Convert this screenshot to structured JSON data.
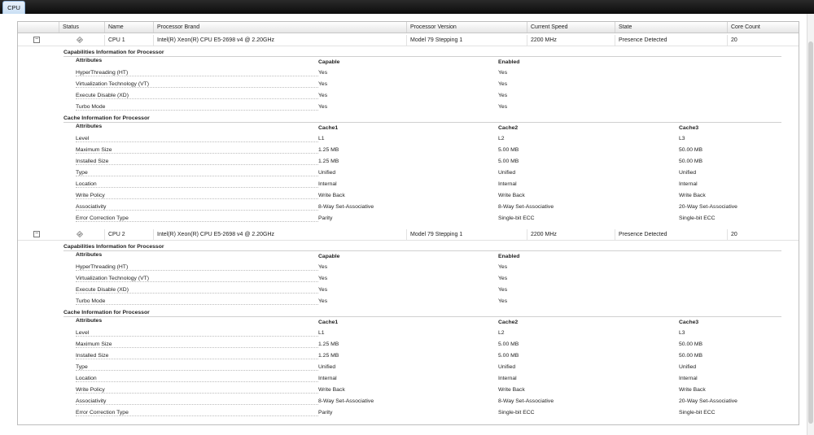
{
  "tab": {
    "label": "CPU"
  },
  "columns": [
    "Status",
    "Name",
    "Processor Brand",
    "Processor Version",
    "Current Speed",
    "State",
    "Core Count"
  ],
  "processors": [
    {
      "toggle": "−",
      "name": "CPU 1",
      "brand": "Intel(R) Xeon(R) CPU E5-2698 v4 @ 2.20GHz",
      "version": "Model 79 Stepping 1",
      "speed": "2200 MHz",
      "state": "Presence Detected",
      "cores": "20",
      "capabilities": {
        "title": "Capabilities Information for Processor",
        "headers": [
          "Attributes",
          "Capable",
          "Enabled"
        ],
        "rows": [
          {
            "label": "HyperThreading (HT)",
            "capable": "Yes",
            "enabled": "Yes"
          },
          {
            "label": "Virtualization Technology (VT)",
            "capable": "Yes",
            "enabled": "Yes"
          },
          {
            "label": "Execute Disable (XD)",
            "capable": "Yes",
            "enabled": "Yes"
          },
          {
            "label": "Turbo Mode",
            "capable": "Yes",
            "enabled": "Yes"
          }
        ]
      },
      "cache": {
        "title": "Cache Information for Processor",
        "headers": [
          "Attributes",
          "Cache1",
          "Cache2",
          "Cache3"
        ],
        "rows": [
          {
            "label": "Level",
            "c1": "L1",
            "c2": "L2",
            "c3": "L3"
          },
          {
            "label": "Maximum Size",
            "c1": "1.25 MB",
            "c2": "5.00 MB",
            "c3": "50.00 MB"
          },
          {
            "label": "Installed Size",
            "c1": "1.25 MB",
            "c2": "5.00 MB",
            "c3": "50.00 MB"
          },
          {
            "label": "Type",
            "c1": "Unified",
            "c2": "Unified",
            "c3": "Unified"
          },
          {
            "label": "Location",
            "c1": "Internal",
            "c2": "Internal",
            "c3": "Internal"
          },
          {
            "label": "Write Policy",
            "c1": "Write Back",
            "c2": "Write Back",
            "c3": "Write Back"
          },
          {
            "label": "Associativity",
            "c1": "8-Way Set-Associative",
            "c2": "8-Way Set-Associative",
            "c3": "20-Way Set-Associative"
          },
          {
            "label": "Error Correction Type",
            "c1": "Parity",
            "c2": "Single-bit ECC",
            "c3": "Single-bit ECC"
          }
        ]
      }
    },
    {
      "toggle": "−",
      "name": "CPU 2",
      "brand": "Intel(R) Xeon(R) CPU E5-2698 v4 @ 2.20GHz",
      "version": "Model 79 Stepping 1",
      "speed": "2200 MHz",
      "state": "Presence Detected",
      "cores": "20",
      "capabilities": {
        "title": "Capabilities Information for Processor",
        "headers": [
          "Attributes",
          "Capable",
          "Enabled"
        ],
        "rows": [
          {
            "label": "HyperThreading (HT)",
            "capable": "Yes",
            "enabled": "Yes"
          },
          {
            "label": "Virtualization Technology (VT)",
            "capable": "Yes",
            "enabled": "Yes"
          },
          {
            "label": "Execute Disable (XD)",
            "capable": "Yes",
            "enabled": "Yes"
          },
          {
            "label": "Turbo Mode",
            "capable": "Yes",
            "enabled": "Yes"
          }
        ]
      },
      "cache": {
        "title": "Cache Information for Processor",
        "headers": [
          "Attributes",
          "Cache1",
          "Cache2",
          "Cache3"
        ],
        "rows": [
          {
            "label": "Level",
            "c1": "L1",
            "c2": "L2",
            "c3": "L3"
          },
          {
            "label": "Maximum Size",
            "c1": "1.25 MB",
            "c2": "5.00 MB",
            "c3": "50.00 MB"
          },
          {
            "label": "Installed Size",
            "c1": "1.25 MB",
            "c2": "5.00 MB",
            "c3": "50.00 MB"
          },
          {
            "label": "Type",
            "c1": "Unified",
            "c2": "Unified",
            "c3": "Unified"
          },
          {
            "label": "Location",
            "c1": "Internal",
            "c2": "Internal",
            "c3": "Internal"
          },
          {
            "label": "Write Policy",
            "c1": "Write Back",
            "c2": "Write Back",
            "c3": "Write Back"
          },
          {
            "label": "Associativity",
            "c1": "8-Way Set-Associative",
            "c2": "8-Way Set-Associative",
            "c3": "20-Way Set-Associative"
          },
          {
            "label": "Error Correction Type",
            "c1": "Parity",
            "c2": "Single-bit ECC",
            "c3": "Single-bit ECC"
          }
        ]
      }
    }
  ]
}
